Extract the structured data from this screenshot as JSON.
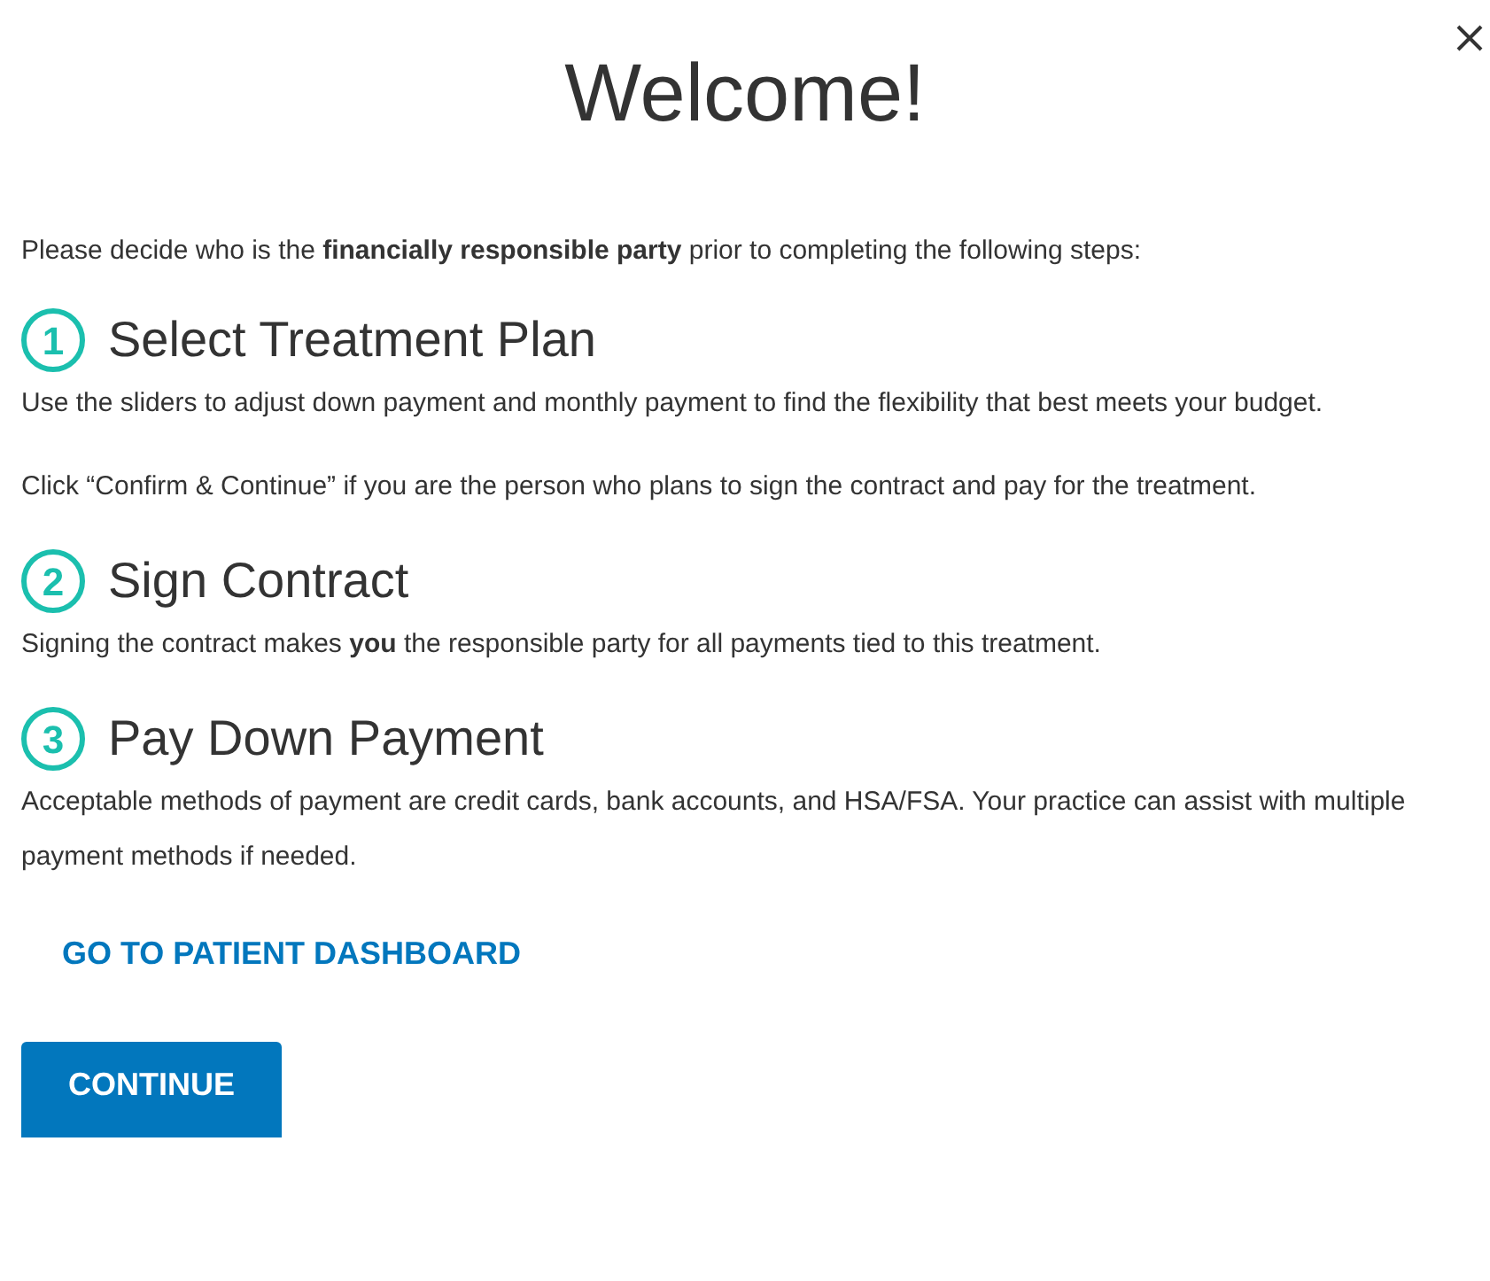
{
  "title": "Welcome!",
  "intro": "Please decide who is the **financially responsible party** prior to completing the following steps:",
  "steps": [
    {
      "number": "1",
      "heading": "Select Treatment Plan",
      "paragraphs": [
        "Use the sliders to adjust down payment and monthly payment to find the flexibility that best meets your budget.",
        "Click “Confirm & Continue” if you are the person who plans to sign the contract and pay for the treatment."
      ]
    },
    {
      "number": "2",
      "heading": "Sign Contract",
      "paragraphs": [
        "Signing the contract makes **you** the responsible party for all payments tied to this treatment."
      ]
    },
    {
      "number": "3",
      "heading": "Pay Down Payment",
      "paragraphs": [
        "Acceptable methods of payment are credit cards, bank accounts, and HSA/FSA. Your practice can assist with multiple payment methods if needed."
      ]
    }
  ],
  "link": "GO TO PATIENT DASHBOARD",
  "button": "CONTINUE"
}
